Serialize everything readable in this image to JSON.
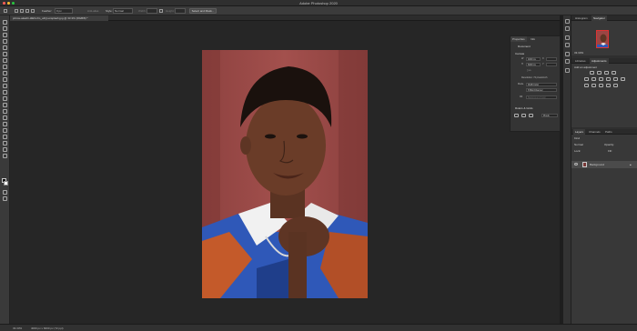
{
  "app": {
    "title": "Adobe Photoshop 2020",
    "traffic_lights": [
      "#ff5f57",
      "#febc2e",
      "#28c840"
    ]
  },
  "options_bar": {
    "feather_label": "Feather:",
    "feather_value": "0 px",
    "anti_alias_label": "Anti-alias",
    "style_label": "Style:",
    "style_value": "Normal",
    "width_label": "Width:",
    "height_label": "Height:",
    "select_mask_button": "Select and Mask..."
  },
  "document": {
    "tab_title": "prince-akachi-i2EhcJm_o4Q-unsplash.jpg @ 33.3% (RGB/8) *"
  },
  "properties_panel": {
    "tabs": [
      "Properties",
      "Info"
    ],
    "doc_label": "Document",
    "canvas_section": "Canvas",
    "width_value": "4000 px",
    "height_value": "6000 px",
    "x_label": "X",
    "y_label": "Y",
    "resolution": "Resolution: 72 pixels/inch",
    "mode_label": "Mode",
    "mode_value": "RGB Color",
    "depth_value": "8 Bits/Channel",
    "fill_label": "Fill",
    "fill_value": "Background Color",
    "rulers_section": "Rulers & Grids",
    "units_value": "Pixels"
  },
  "right_panels": {
    "top_tabs": [
      "Histogram",
      "Navigator"
    ],
    "zoom_value": "33.33%",
    "adj_tabs": [
      "Libraries",
      "Adjustments"
    ],
    "adj_hint": "Add an adjustment",
    "layer_tabs": [
      "Layers",
      "Channels",
      "Paths"
    ],
    "kind_label": "Kind",
    "blend_mode": "Normal",
    "opacity_label": "Opacity:",
    "lock_label": "Lock:",
    "fill_label": "Fill:",
    "layer_name": "Background"
  },
  "status_bar": {
    "zoom": "33.33%",
    "doc_size": "4000 px x 6000 px (72 ppi)"
  },
  "colors": {
    "foreground": "#111111",
    "background": "#ffffff",
    "photo_wall": "#9c4a48"
  }
}
